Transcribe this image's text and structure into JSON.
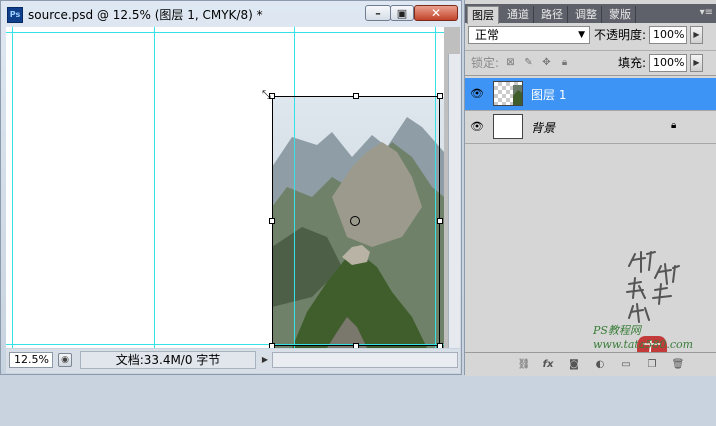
{
  "document_window": {
    "app_icon": "ps-logo",
    "title": "source.psd @ 12.5% (图层 1, CMYK/8) *",
    "minimize_icon": "minimize-icon",
    "maximize_icon": "maximize-icon",
    "close_icon": "close-icon"
  },
  "status_bar": {
    "zoom": "12.5%",
    "doc_info": "文档:33.4M/0 字节"
  },
  "panel": {
    "tabs": [
      "图层",
      "通道",
      "路径",
      "调整",
      "蒙版"
    ],
    "active_tab": 0,
    "blend_mode": "正常",
    "opacity_label": "不透明度:",
    "opacity_value": "100%",
    "lock_label": "锁定:",
    "fill_label": "填充:",
    "fill_value": "100%",
    "layers": [
      {
        "name": "图层 1",
        "selected": true,
        "visible": true,
        "locked": false
      },
      {
        "name": "背景",
        "selected": false,
        "visible": true,
        "locked": true
      }
    ],
    "bottom_icons": [
      "link-layers-icon",
      "fx-icon",
      "add-mask-icon",
      "adjustment-icon",
      "new-group-icon",
      "new-layer-icon",
      "delete-icon"
    ]
  },
  "colors": {
    "guide": "#34e2e8",
    "selected_layer": "#3e94f5",
    "tab_bar": "#5e6169"
  }
}
